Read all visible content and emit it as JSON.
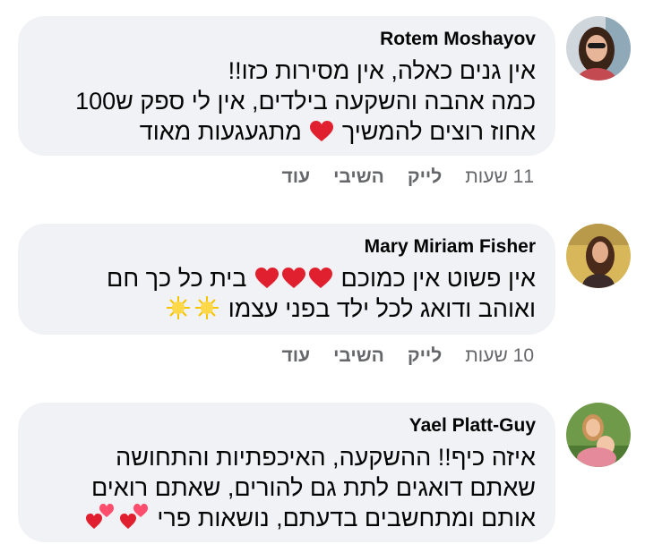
{
  "comments": [
    {
      "author": "Rotem Moshayov",
      "lines": [
        "אין גנים כאלה, אין מסירות כזו!!",
        "כמה אהבה והשקעה בילדים, אין לי ספק ש100",
        "אחוז רוצים להמשיך",
        "מתגעגעות מאוד"
      ],
      "time": "11 שעות",
      "like": "לייק",
      "reply": "השיבי",
      "more": "עוד"
    },
    {
      "author": "Mary Miriam Fisher",
      "lines": [
        "אין פשוט אין כמוכם",
        "בית כל כך חם",
        "ואוהב ודואג לכל ילד בפני עצמו"
      ],
      "time": "10 שעות",
      "like": "לייק",
      "reply": "השיבי",
      "more": "עוד"
    },
    {
      "author": "Yael Platt-Guy",
      "lines": [
        "איזה כיף!! ההשקעה, האיכפתיות והתחושה",
        "שאתם דואגים לתת גם להורים, שאתם רואים",
        "אותם ומתחשבים בדעתם, נושאות פרי"
      ]
    }
  ],
  "colors": {
    "bubble": "#f0f2f5",
    "meta": "#65676b",
    "heart": "#e0202e"
  }
}
